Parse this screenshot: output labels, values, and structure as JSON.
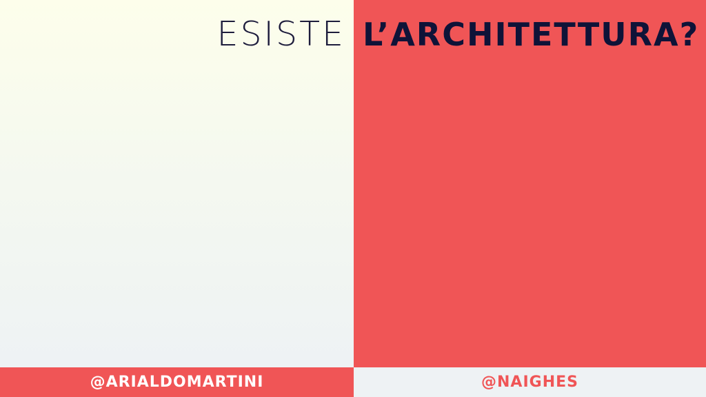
{
  "title": {
    "light": "ESISTE",
    "bold": "L’ARCHITETTURA?"
  },
  "footer": {
    "left_handle": "@ARIALDOMARTINI",
    "right_handle": "@NAIGHES"
  },
  "colors": {
    "accent_red": "#f05556",
    "navy": "#0f1338",
    "light_bg": "#eef2f4",
    "cream_bg": "#fdfeeb"
  }
}
